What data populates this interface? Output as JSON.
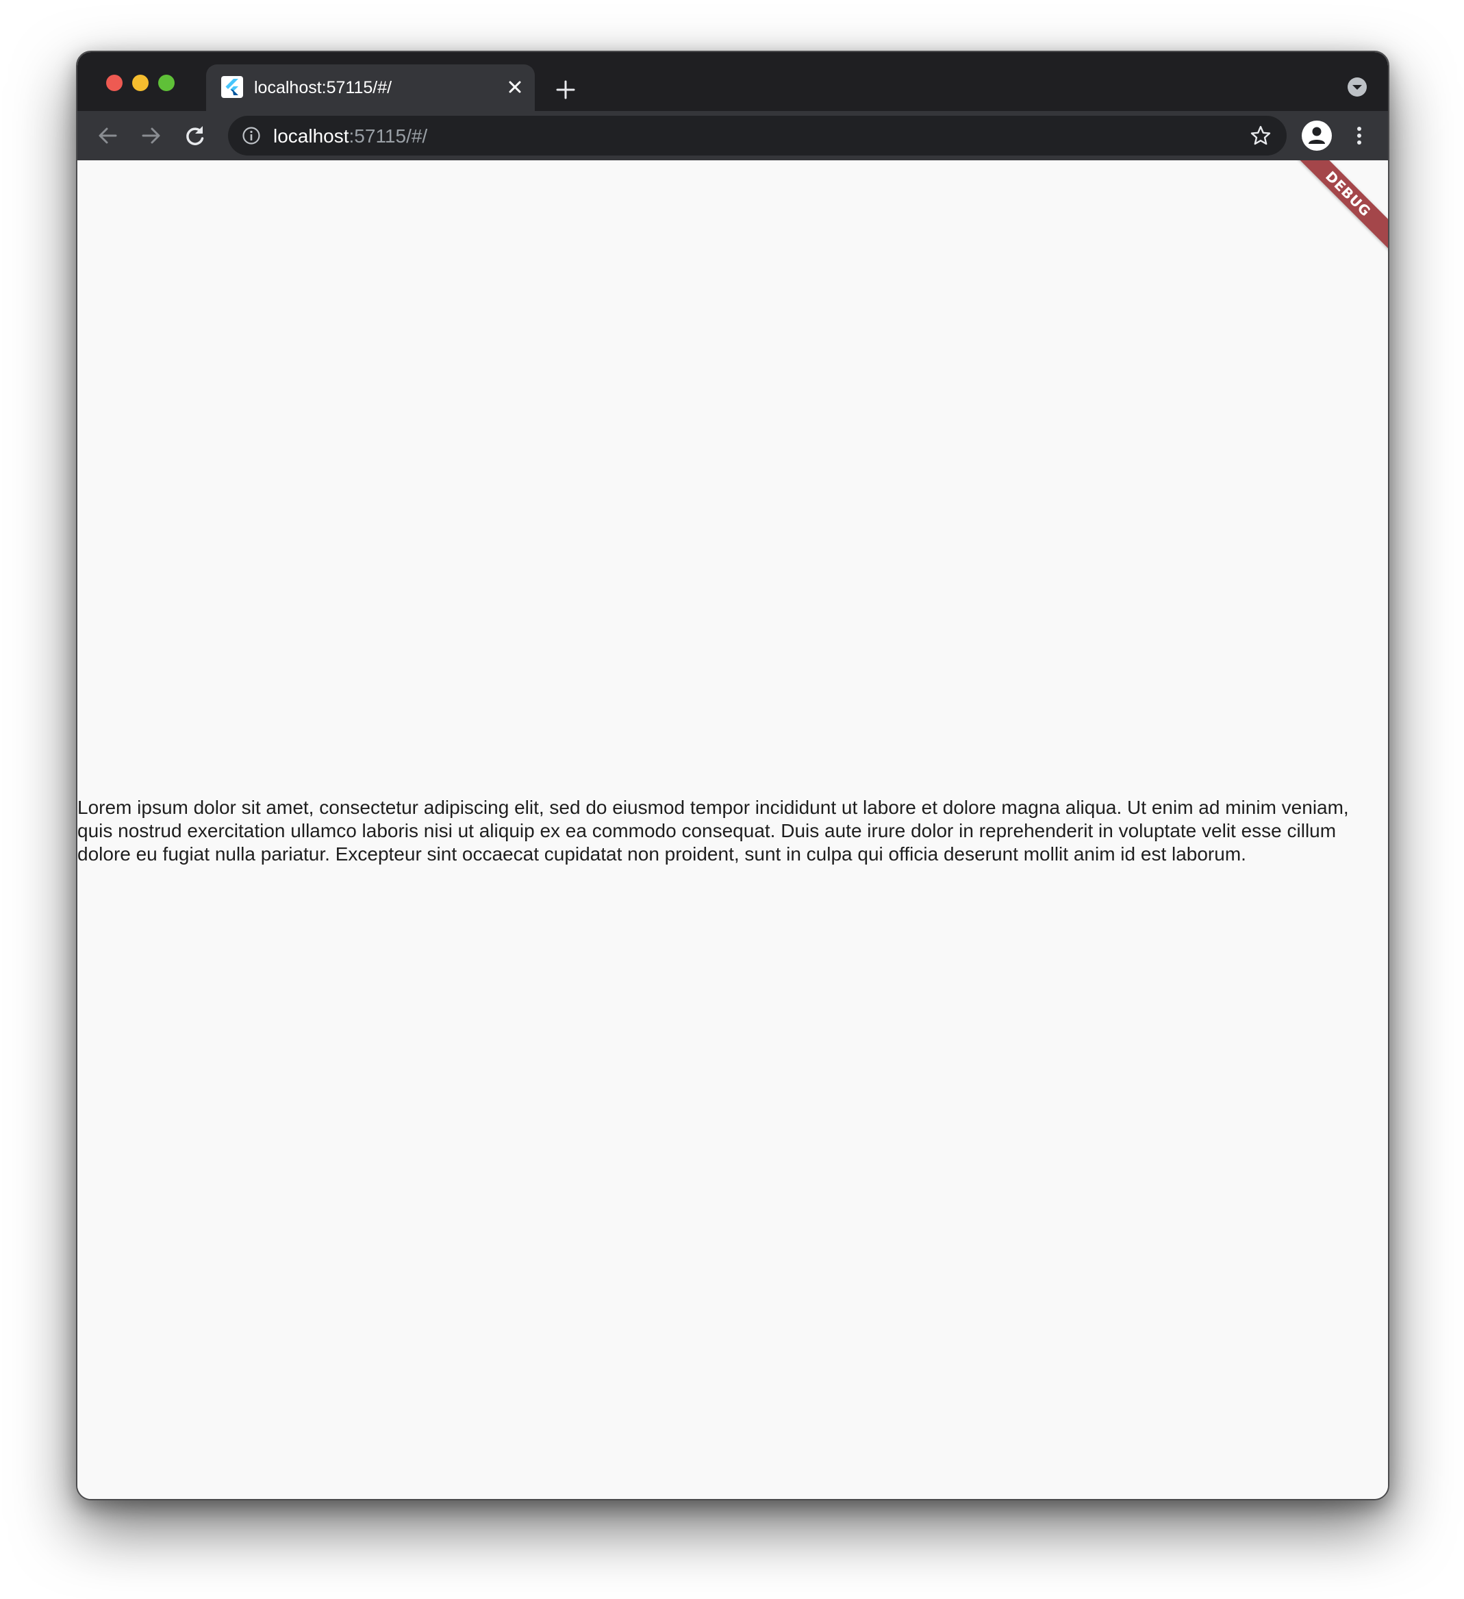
{
  "browser": {
    "tab": {
      "title": "localhost:57115/#/",
      "favicon": "flutter-logo-icon"
    },
    "address_bar": {
      "host": "localhost",
      "path": ":57115/#/"
    },
    "icons": {
      "back": "arrow-left-icon",
      "forward": "arrow-right-icon",
      "reload": "reload-icon",
      "site_info": "info-icon",
      "bookmark": "star-icon",
      "profile": "person-icon",
      "menu": "kebab-menu-icon",
      "tab_search": "chevron-down-icon",
      "new_tab": "plus-icon",
      "close_tab": "close-icon"
    }
  },
  "page": {
    "debug_banner": "DEBUG",
    "body_text": "Lorem ipsum dolor sit amet, consectetur adipiscing elit, sed do eiusmod tempor incididunt ut labore et dolore magna aliqua. Ut enim ad minim veniam, quis nostrud exercitation ullamco laboris nisi ut aliquip ex ea commodo consequat. Duis aute irure dolor in reprehenderit in voluptate velit esse cillum dolore eu fugiat nulla pariatur. Excepteur sint occaecat cupidatat non proident, sunt in culpa qui officia deserunt mollit anim id est laborum."
  },
  "colors": {
    "tabbar_bg": "#1f1f22",
    "toolbar_bg": "#35363a",
    "content_bg": "#f9f9f9",
    "debug_banner": "#a4464a"
  }
}
